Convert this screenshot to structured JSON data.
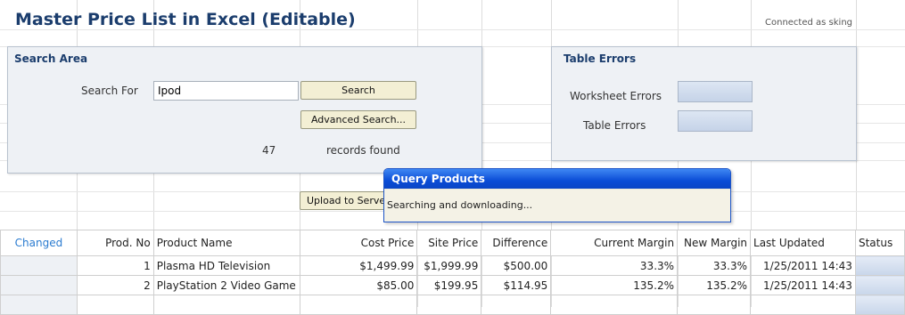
{
  "title": "Master Price List in Excel (Editable)",
  "connected": "Connected as sking",
  "search_area": {
    "title": "Search Area",
    "search_for_label": "Search For",
    "search_value": "Ipod",
    "search_button": "Search",
    "advanced_button": "Advanced Search...",
    "count": "47",
    "records_label": "records found"
  },
  "table_errors": {
    "title": "Table Errors",
    "worksheet_label": "Worksheet Errors",
    "table_label": "Table Errors"
  },
  "upload_button": "Upload to Server",
  "dialog": {
    "title": "Query Products",
    "message": "Searching and downloading..."
  },
  "table": {
    "headers": [
      "Changed",
      "Prod. No",
      "Product Name",
      "Cost Price",
      "Site Price",
      "Difference",
      "Current Margin",
      "New Margin",
      "Last Updated",
      "Status"
    ],
    "rows": [
      {
        "changed": "",
        "no": "1",
        "name": "Plasma HD Television",
        "cost": "$1,499.99",
        "site": "$1,999.99",
        "diff": "$500.00",
        "cur": "33.3%",
        "new": "33.3%",
        "updated": "1/25/2011 14:43"
      },
      {
        "changed": "",
        "no": "2",
        "name": "PlayStation 2 Video Game",
        "cost": "$85.00",
        "site": "$199.95",
        "diff": "$114.95",
        "cur": "135.2%",
        "new": "135.2%",
        "updated": "1/25/2011 14:43"
      }
    ]
  }
}
